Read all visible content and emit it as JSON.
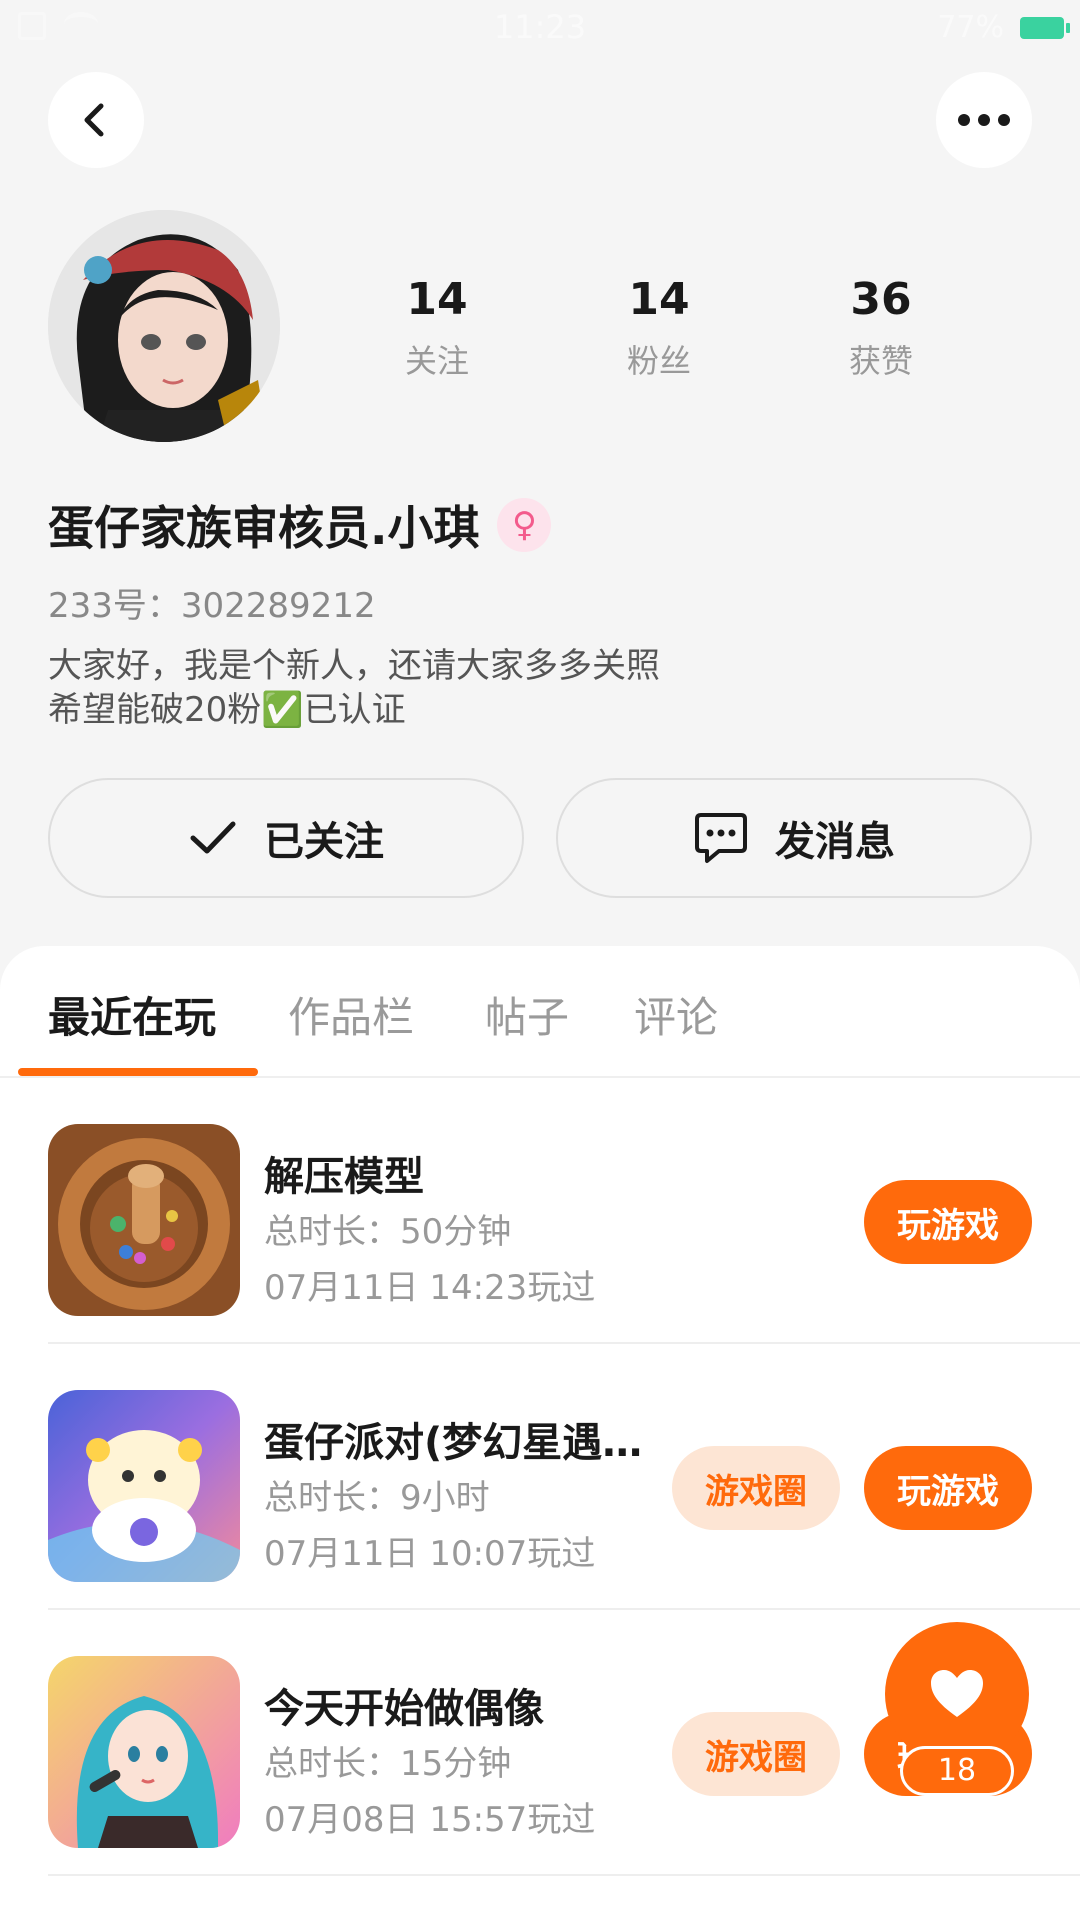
{
  "status_bar": {
    "time": "11:23",
    "battery": "77%"
  },
  "header": {
    "back_icon": "chevron-left-icon",
    "more_icon": "more-horizontal-icon"
  },
  "profile": {
    "stats": [
      {
        "value": "14",
        "label": "关注"
      },
      {
        "value": "14",
        "label": "粉丝"
      },
      {
        "value": "36",
        "label": "获赞"
      }
    ],
    "username": "蛋仔家族审核员.小琪",
    "gender_icon": "female-icon",
    "gender_symbol": "♀",
    "user_id": "233号：302289212",
    "bio_line1": "大家好，我是个新人，还请大家多多关照",
    "bio_line2": "希望能破20粉✅已认证"
  },
  "actions": {
    "follow_label": "已关注",
    "message_label": "发消息"
  },
  "tabs": [
    {
      "label": "最近在玩",
      "active": true
    },
    {
      "label": "作品栏",
      "active": false
    },
    {
      "label": "帖子",
      "active": false
    },
    {
      "label": "评论",
      "active": false
    }
  ],
  "games": [
    {
      "title": "解压模型",
      "duration": "总时长：50分钟",
      "last_played": "07月11日 14:23玩过",
      "play_label": "玩游戏"
    },
    {
      "title": "蛋仔派对(梦幻星遇…",
      "duration": "总时长：9小时",
      "last_played": "07月11日 10:07玩过",
      "circle_label": "游戏圈",
      "play_label": "玩游戏"
    },
    {
      "title": "今天开始做偶像",
      "duration": "总时长：15分钟",
      "last_played": "07月08日 15:57玩过",
      "circle_label": "游戏圈",
      "play_label": "玩游戏"
    }
  ],
  "fab": {
    "icon": "heart-icon",
    "count": "18"
  },
  "colors": {
    "accent": "#ff6a0c",
    "accent_light": "#fde5d4",
    "background": "#f5f5f5"
  }
}
